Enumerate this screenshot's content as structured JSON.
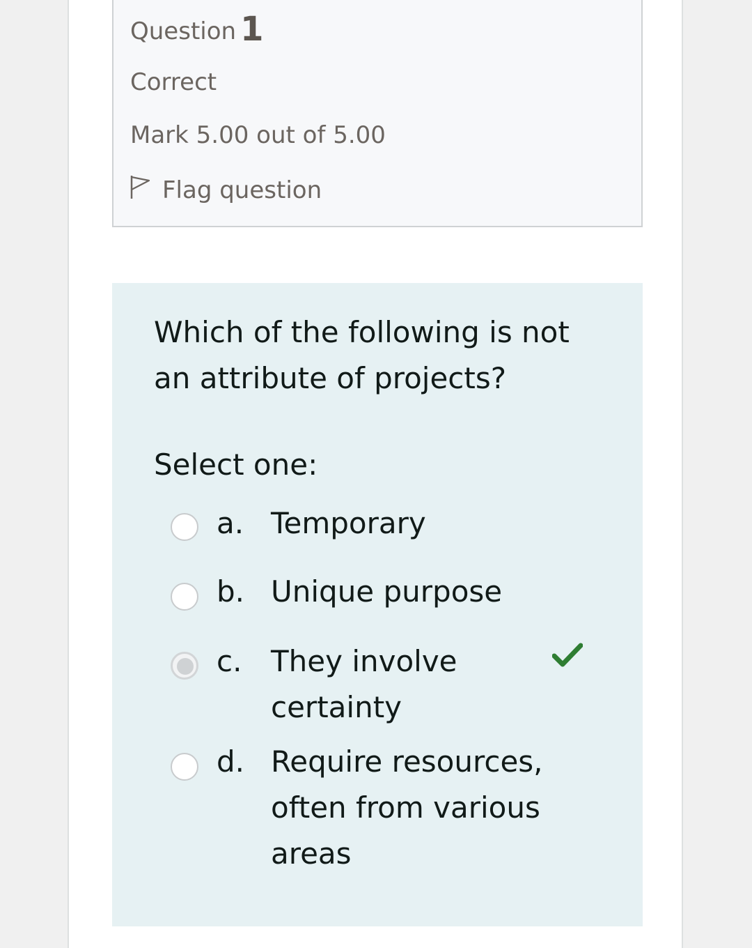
{
  "info": {
    "question_label": "Question",
    "question_number": "1",
    "state": "Correct",
    "grade": "Mark 5.00 out of 5.00",
    "flag_label": "Flag question"
  },
  "question": {
    "text": "Which of the following is not an attribute of projects?",
    "prompt": "Select one:",
    "options": [
      {
        "letter": "a.",
        "text": "Temporary",
        "selected": false,
        "correct": false
      },
      {
        "letter": "b.",
        "text": "Unique purpose",
        "selected": false,
        "correct": false
      },
      {
        "letter": "c.",
        "text": "They involve certainty",
        "selected": true,
        "correct": true
      },
      {
        "letter": "d.",
        "text": "Require resources, often from various areas",
        "selected": false,
        "correct": false
      }
    ]
  },
  "colors": {
    "question_bg": "#e6f1f3",
    "info_bg": "#f7f8fa",
    "correct_check": "#2e7d32"
  },
  "icons": {
    "flag": "flag-outline-icon",
    "correct": "check-icon"
  }
}
